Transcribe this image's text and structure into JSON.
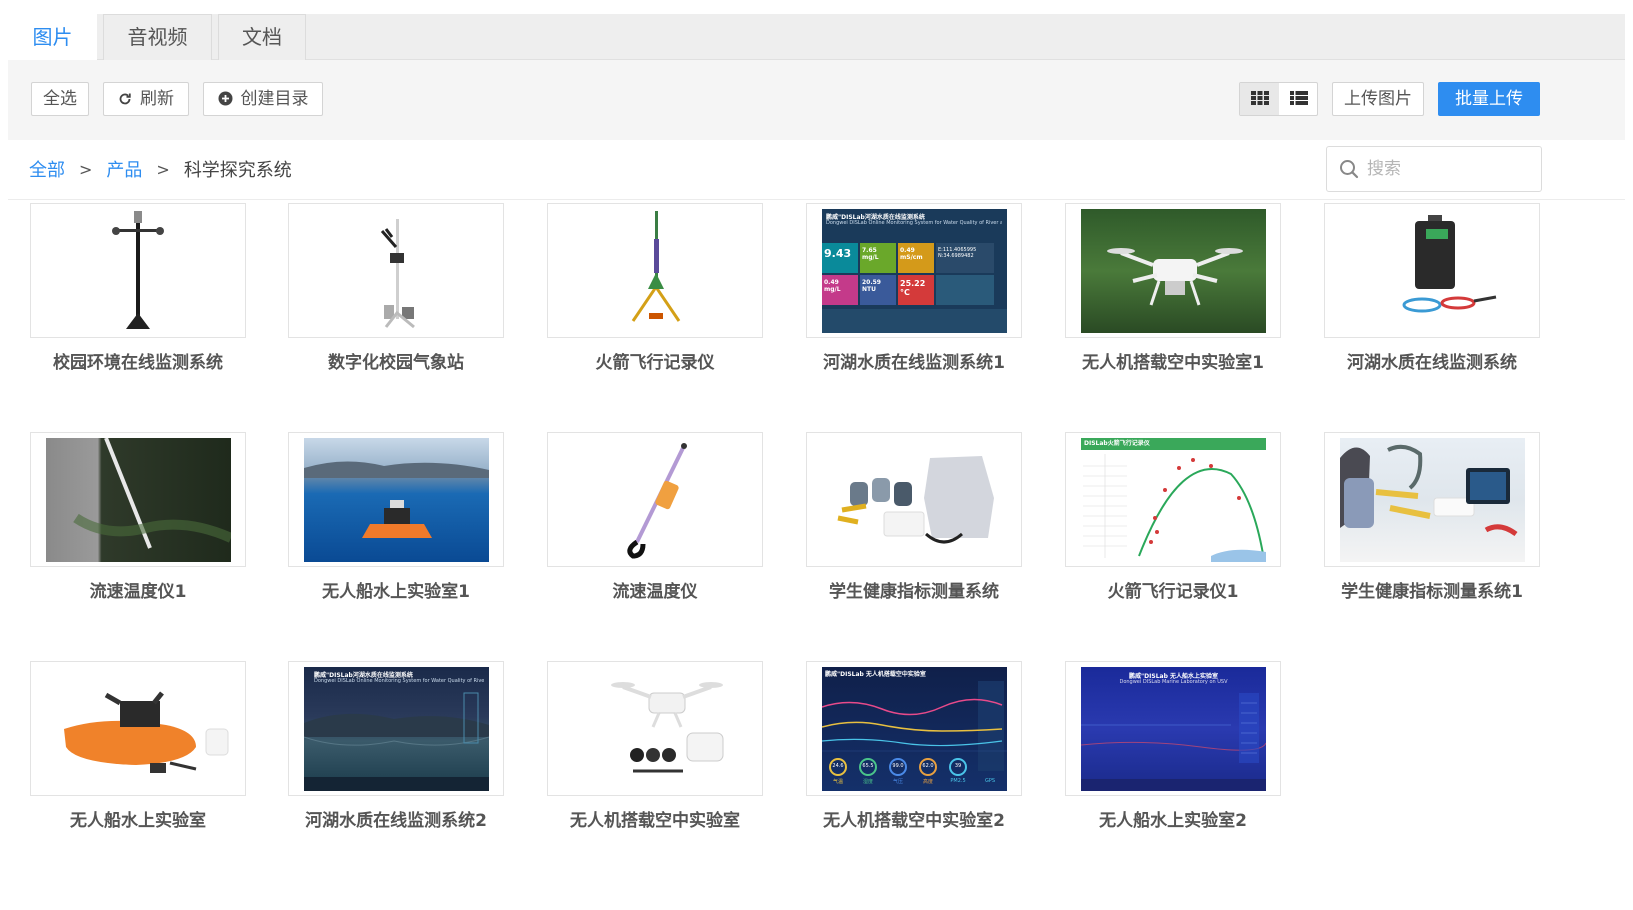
{
  "tabs": [
    {
      "label": "图片",
      "active": true
    },
    {
      "label": "音视频",
      "active": false
    },
    {
      "label": "文档",
      "active": false
    }
  ],
  "toolbar": {
    "select_all": "全选",
    "refresh": "刷新",
    "create_dir": "创建目录",
    "view_modes": [
      "grid-view-icon",
      "list-view-icon"
    ],
    "active_view": "grid",
    "upload": "上传图片",
    "batch_upload": "批量上传"
  },
  "breadcrumb": {
    "items": [
      "全部",
      "产品"
    ],
    "separator": ">",
    "current": "科学探究系统"
  },
  "search": {
    "placeholder": "搜索",
    "value": ""
  },
  "colors": {
    "accent": "#2e8df0",
    "toolbar_bg": "#f5f5f5",
    "tab_bg": "#eeeeee"
  },
  "images": [
    {
      "name": "校园环境在线监测系统",
      "kind": "pole"
    },
    {
      "name": "数字化校园气象站",
      "kind": "station"
    },
    {
      "name": "火箭飞行记录仪",
      "kind": "rocket"
    },
    {
      "name": "河湖水质在线监测系统1",
      "kind": "dashboard",
      "screen": {
        "title": "鹏威\"DISLab河湖水质在线监测系统",
        "subtitle": "Dongwei DISLab Online Monitoring System for Water Quality of River and Lake",
        "tiles": [
          "9.43",
          "7.65 mg/L",
          "0.49 mS/cm",
          "E:111.4065995",
          "N:34.6989482",
          "0.49 mg/L",
          "20.59 NTU",
          "25.22 °C"
        ]
      }
    },
    {
      "name": "无人机搭载空中实验室1",
      "kind": "drone-forest"
    },
    {
      "name": "河湖水质在线监测系统",
      "kind": "suitcase"
    },
    {
      "name": "流速温度仪1",
      "kind": "river"
    },
    {
      "name": "无人船水上实验室1",
      "kind": "lake-boat"
    },
    {
      "name": "流速温度仪",
      "kind": "probe"
    },
    {
      "name": "学生健康指标测量系统",
      "kind": "health-kit"
    },
    {
      "name": "火箭飞行记录仪1",
      "kind": "rocket-chart",
      "screen": {
        "title": "DISLab火箭飞行记录仪"
      }
    },
    {
      "name": "学生健康指标测量系统1",
      "kind": "health-photo"
    },
    {
      "name": "无人船水上实验室",
      "kind": "orange-boat"
    },
    {
      "name": "河湖水质在线监测系统2",
      "kind": "lake-dark",
      "screen": {
        "title": "鹏威\"DISLab河湖水质在线监测系统",
        "subtitle": "Dongwei DISLab Online Monitoring System for Water Quality of River and Lake"
      }
    },
    {
      "name": "无人机搭载空中实验室",
      "kind": "drone-kit"
    },
    {
      "name": "无人机搭载空中实验室2",
      "kind": "drone-chart",
      "screen": {
        "title": "鹏威\"DISLab 无人机搭载空中实验室",
        "gauges": [
          "24.6",
          "65.5",
          "99.0",
          "62.0",
          "39"
        ],
        "gauge_labels": [
          "气温",
          "湿度",
          "气压",
          "高度",
          "PM2.5",
          "GPS"
        ]
      }
    },
    {
      "name": "无人船水上实验室2",
      "kind": "usv-screen",
      "screen": {
        "title": "鹏威\"DISLab 无人船水上实验室",
        "subtitle": "Dongwei DISLab Marine Laboratory on USV"
      }
    }
  ]
}
